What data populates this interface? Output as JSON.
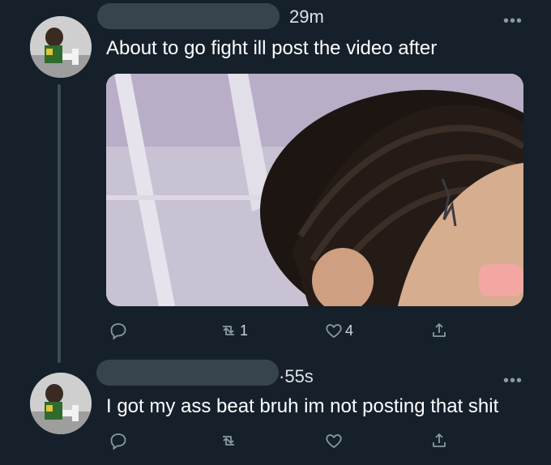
{
  "tweets": [
    {
      "time": "29m",
      "text": "About to go fight ill post the video after",
      "more_label": "•••",
      "actions": {
        "reply_count": "",
        "retweet_count": "1",
        "like_count": "4"
      }
    },
    {
      "time": "55s",
      "time_prefix": "·",
      "text": "I got my ass beat bruh im not posting that shit",
      "more_label": "•••",
      "actions": {
        "reply_count": "",
        "retweet_count": "",
        "like_count": ""
      }
    }
  ],
  "colors": {
    "background": "#15202b",
    "icon_gray": "#8b98a5",
    "thread_line": "#3d4b58",
    "redaction": "#38444d"
  },
  "icons": [
    "reply-icon",
    "retweet-icon",
    "like-icon",
    "share-icon",
    "more-icon"
  ]
}
